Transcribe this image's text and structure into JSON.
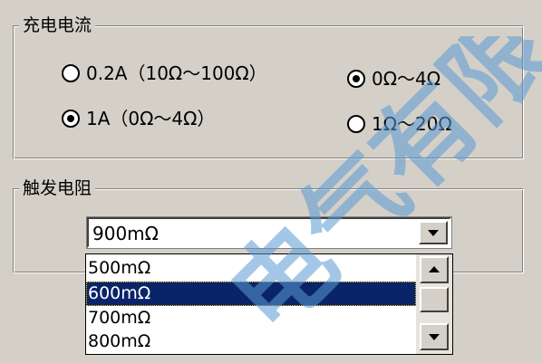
{
  "charge_group": {
    "title": "充电电流",
    "options": [
      {
        "label": "0.2A（10Ω～100Ω）",
        "selected": false
      },
      {
        "label": "1A（0Ω～4Ω）",
        "selected": true
      }
    ],
    "range_options": [
      {
        "label": "0Ω～4Ω",
        "selected": true
      },
      {
        "label": "1Ω～20Ω",
        "selected": false
      }
    ]
  },
  "trigger_group": {
    "title": "触发电阻",
    "combo_value": "900mΩ",
    "list_items": [
      "500mΩ",
      "600mΩ",
      "700mΩ",
      "800mΩ"
    ],
    "selected_item": "600mΩ"
  },
  "watermark": "电气有限",
  "colors": {
    "background": "#d4d0c8",
    "selection": "#0a246a",
    "watermark": "#5b9bd5"
  }
}
